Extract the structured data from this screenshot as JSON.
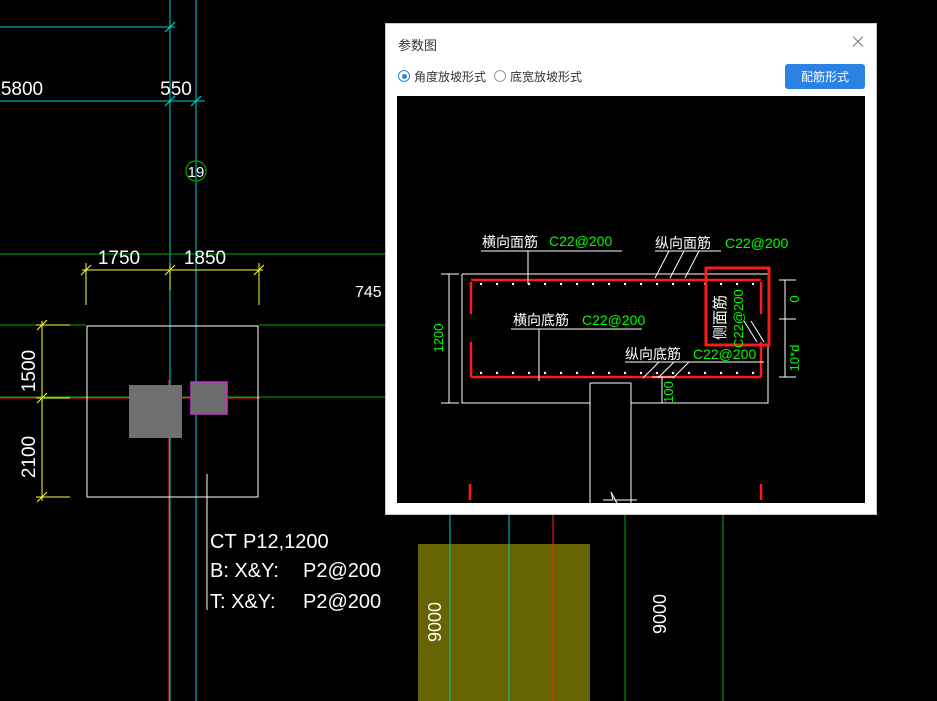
{
  "cad": {
    "dims": {
      "d_5800": "5800",
      "d_550": "550",
      "d_1750": "1750",
      "d_1850": "1850",
      "d_745": "745",
      "d_1500": "1500",
      "d_2100": "2100",
      "d_9000_left": "9000",
      "d_9000_right": "9000"
    },
    "grid_bubble": "19",
    "cap_label": {
      "line1_a": "CT",
      "line1_b": "P12,1200",
      "line2_a": "B: X&Y:",
      "line2_b": "P2@200",
      "line3_a": "T: X&Y:",
      "line3_b": "P2@200"
    }
  },
  "dialog": {
    "title": "参数图",
    "radio_angle": "角度放坡形式",
    "radio_width": "底宽放坡形式",
    "radio_selected": "角度放坡形式",
    "rebar_button": "配筋形式",
    "diagram": {
      "h_top_label": "横向面筋",
      "h_top_value": "C22@200",
      "v_top_label": "纵向面筋",
      "v_top_value": "C22@200",
      "h_bot_label": "横向底筋",
      "h_bot_value": "C22@200",
      "v_bot_label": "纵向底筋",
      "v_bot_value": "C22@200",
      "side_label": "侧面筋",
      "side_value": "C22@200",
      "dim_1200": "1200",
      "dim_0": "0",
      "dim_10d": "10*d",
      "dim_100": "100"
    }
  },
  "colors": {
    "cad_white": "#ffffff",
    "cad_cyan": "#00cccc",
    "cad_green": "#00aa00",
    "cad_red": "#ff2020",
    "cad_yellow": "#ffff33",
    "pier_gray": "#707070",
    "olive_fill": "#656400",
    "accent_blue": "#2a82e4",
    "diagram_green": "#00ff00",
    "rebar_red": "#ff1a1a"
  }
}
